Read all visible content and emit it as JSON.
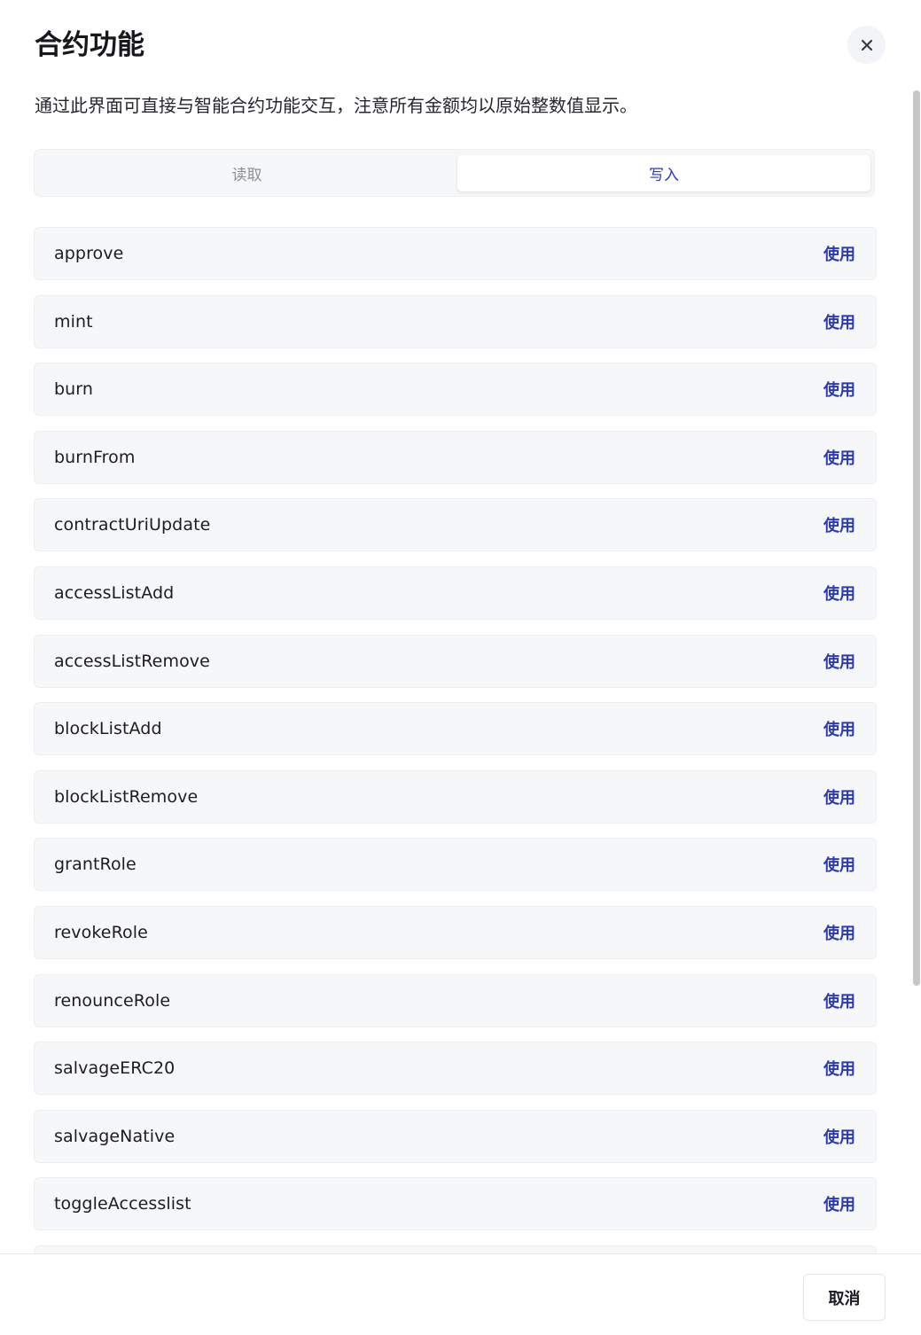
{
  "dialog": {
    "title": "合约功能",
    "description": "通过此界面可直接与智能合约功能交互，注意所有金额均以原始整数值显示。",
    "close_icon": "close-icon"
  },
  "tabs": [
    {
      "label": "读取",
      "active": false
    },
    {
      "label": "写入",
      "active": true
    }
  ],
  "functions": {
    "use_label": "使用",
    "items": [
      "approve",
      "mint",
      "burn",
      "burnFrom",
      "contractUriUpdate",
      "accessListAdd",
      "accessListRemove",
      "blockListAdd",
      "blockListRemove",
      "grantRole",
      "revokeRole",
      "renounceRole",
      "salvageERC20",
      "salvageNative",
      "toggleAccesslist"
    ]
  },
  "footer": {
    "cancel_label": "取消"
  },
  "colors": {
    "accent": "#2b3ab8",
    "row_bg": "#f6f7f9",
    "row_border": "#eceef2"
  }
}
